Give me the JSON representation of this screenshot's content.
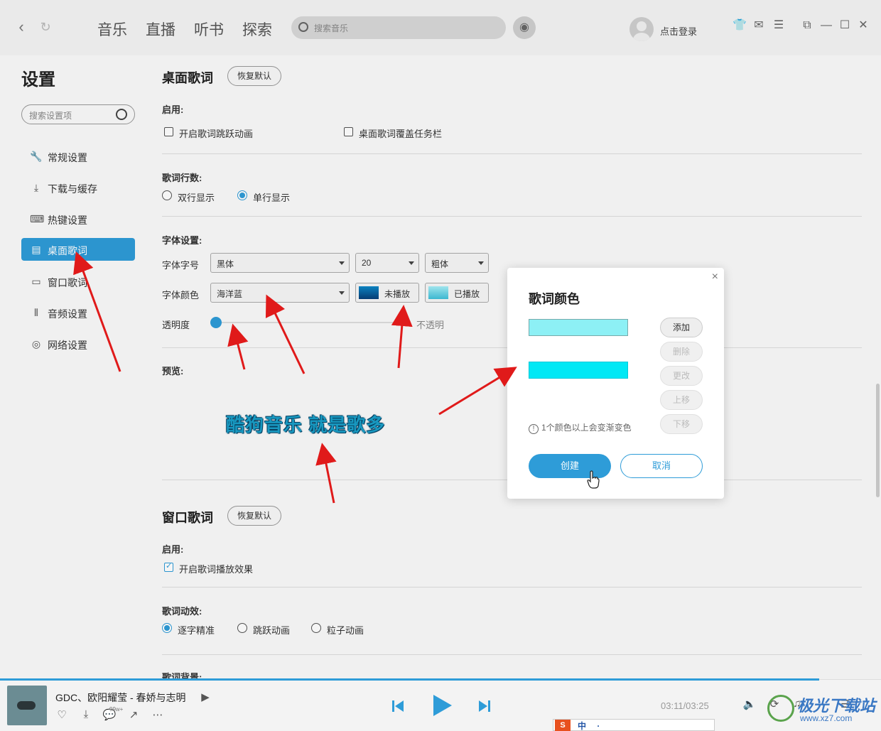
{
  "topbar": {
    "tabs": [
      "音乐",
      "直播",
      "听书",
      "探索"
    ],
    "search_placeholder": "搜索音乐",
    "login": "点击登录"
  },
  "sidebar": {
    "title": "设置",
    "search_placeholder": "搜索设置项",
    "items": [
      {
        "label": "常规设置",
        "icon": "wrench-icon"
      },
      {
        "label": "下载与缓存",
        "icon": "download-icon"
      },
      {
        "label": "热键设置",
        "icon": "keyboard-icon"
      },
      {
        "label": "桌面歌词",
        "icon": "lyrics-icon"
      },
      {
        "label": "窗口歌词",
        "icon": "window-icon"
      },
      {
        "label": "音频设置",
        "icon": "audio-wave-icon"
      },
      {
        "label": "网络设置",
        "icon": "globe-icon"
      }
    ],
    "active_index": 3
  },
  "desktop_lyrics": {
    "title": "桌面歌词",
    "reset": "恢复默认",
    "enable_label": "启用:",
    "opt_jump": "开启歌词跳跃动画",
    "opt_taskbar": "桌面歌词覆盖任务栏",
    "lines_label": "歌词行数:",
    "lines_double": "双行显示",
    "lines_single": "单行显示",
    "font_label": "字体设置:",
    "font_row_label": "字体字号",
    "font_family": "黑体",
    "font_size": "20",
    "font_weight": "粗体",
    "color_row_label": "字体颜色",
    "color_scheme": "海洋蓝",
    "unplayed": "未播放",
    "played": "已播放",
    "opacity_label": "透明度",
    "opacity_end": "不透明",
    "opacity_value": 0,
    "preview_label": "预览:",
    "preview_text": "酷狗音乐  就是歌多"
  },
  "window_lyrics": {
    "title": "窗口歌词",
    "reset": "恢复默认",
    "enable_label": "启用:",
    "opt_effect": "开启歌词播放效果",
    "effect_label": "歌词动效:",
    "effect_1": "逐字精准",
    "effect_2": "跳跃动画",
    "effect_3": "粒子动画",
    "bg_label": "歌词背景:"
  },
  "modal": {
    "title": "歌词颜色",
    "color1": "#8df0f5",
    "color2": "#00e8f5",
    "btn_add": "添加",
    "btn_delete": "删除",
    "btn_change": "更改",
    "btn_up": "上移",
    "btn_down": "下移",
    "hint": "1个颜色以上会变渐变色",
    "create": "创建",
    "cancel": "取消"
  },
  "player": {
    "song": "GDC、欧阳耀莹 - 春娇与志明",
    "count": "99w+",
    "time": "03:11/03:25",
    "progress": 0.93
  },
  "watermark": {
    "line1": "极光下载站",
    "line2": "www.xz7.com"
  },
  "ime": {
    "logo": "S",
    "text": "中 ·"
  },
  "colors": {
    "accent": "#2e9cd8",
    "unplayed_swatch": "#0a6fb0",
    "played_swatch": "#6fd6ea"
  }
}
